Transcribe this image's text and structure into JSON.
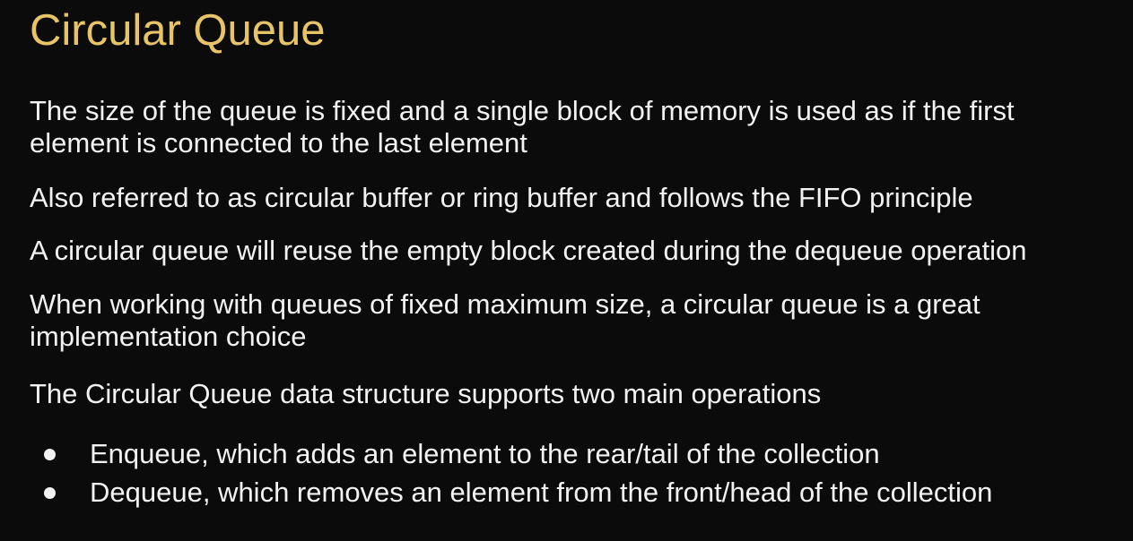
{
  "title": "Circular Queue",
  "paragraphs": [
    {
      "lines": [
        "The size of the queue is fixed and a single block of memory is used as if the first",
        "element is connected to the last element"
      ]
    },
    {
      "lines": [
        "Also referred to as circular buffer or ring buffer and follows the FIFO principle"
      ]
    },
    {
      "lines": [
        "A circular queue will reuse the empty block created during the dequeue operation"
      ]
    },
    {
      "lines": [
        "When working with queues of fixed maximum size, a circular queue is a great",
        "implementation choice"
      ]
    },
    {
      "lines": [
        "The Circular Queue data structure supports two main operations"
      ]
    }
  ],
  "bullets": [
    "Enqueue, which adds an element to the rear/tail of the collection",
    "Dequeue, which removes an element from the front/head of the collection"
  ],
  "colors": {
    "background": "#0b0b0b",
    "title": "#e8c468",
    "text": "#f2f2f2"
  }
}
